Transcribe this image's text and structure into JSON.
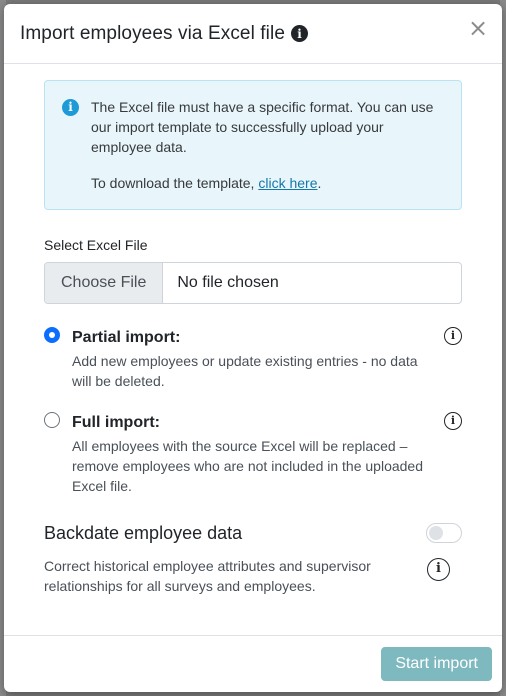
{
  "modal": {
    "title": "Import employees via Excel file",
    "title_icon": "info-circle-filled-icon",
    "close_icon": "close-x-icon"
  },
  "alert": {
    "icon": "info-circle-filled-icon",
    "text": "The Excel file must have a specific format. You can use our import template to successfully upload your employee data.",
    "download_prefix": "To download the template, ",
    "download_link": "click here",
    "download_suffix": "."
  },
  "file_field": {
    "label": "Select Excel File",
    "button": "Choose File",
    "status": "No file chosen"
  },
  "options": [
    {
      "title": "Partial import:",
      "description": "Add new employees or update existing entries - no data will be deleted.",
      "checked": true
    },
    {
      "title": "Full import:",
      "description": "All employees with the source Excel will be replaced – remove employees who are not included in the uploaded Excel file.",
      "checked": false
    }
  ],
  "backdate": {
    "title": "Backdate employee data",
    "description": "Correct historical employee attributes and supervisor relationships for all surveys and employees.",
    "enabled": false
  },
  "footer": {
    "start_button": "Start import"
  },
  "colors": {
    "alert_bg": "#e8f6fc",
    "alert_icon": "#1e9ad6",
    "link": "#1577a8",
    "radio_checked": "#0d6efd",
    "start_button": "#7fb9c0"
  }
}
